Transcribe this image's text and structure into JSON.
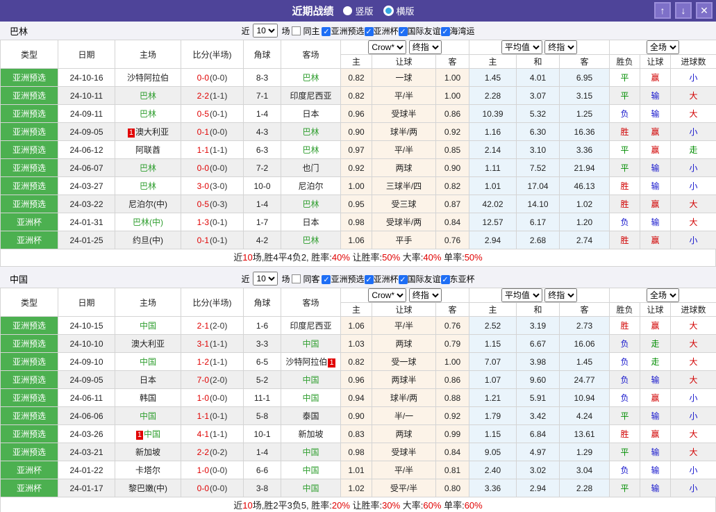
{
  "window": {
    "title": "近期战绩",
    "radios": [
      {
        "label": "竖版",
        "selected": false
      },
      {
        "label": "横版",
        "selected": true
      }
    ],
    "buttons": {
      "up": "↑",
      "down": "↓",
      "close": "✕"
    },
    "colors": {
      "titlebar": "#4e4499",
      "button": "#7e70c8"
    }
  },
  "table_header": {
    "static_cols": [
      "类型",
      "日期",
      "主场",
      "比分(半场)",
      "角球",
      "客场"
    ],
    "odds_group1": {
      "select1": "Crow*",
      "select2": "终指",
      "subcols": [
        "主",
        "让球",
        "客"
      ]
    },
    "odds_group2": {
      "select1": "平均值",
      "select2": "终指",
      "subcols": [
        "主",
        "和",
        "客"
      ]
    },
    "result_group": {
      "select": "全场",
      "subcols": [
        "胜负",
        "让球",
        "进球数"
      ]
    }
  },
  "result_colors": {
    "胜": "#d10000",
    "平": "#008d00",
    "负": "#1515cc",
    "赢": "#d10000",
    "输": "#1515cc",
    "走": "#008d00",
    "大": "#d10000",
    "小": "#1515cc"
  },
  "type_color": "#4cb050",
  "team_highlight_color": "#2f9e2f",
  "sections": [
    {
      "team": "巴林",
      "filter": {
        "prefix": "近",
        "count": "10",
        "suffix": "场",
        "same": {
          "label": "同主",
          "checked": false
        },
        "comps": [
          {
            "label": "亚洲预选",
            "checked": true
          },
          {
            "label": "亚洲杯",
            "checked": true
          },
          {
            "label": "国际友谊",
            "checked": true
          },
          {
            "label": "海湾运",
            "checked": true
          }
        ]
      },
      "rows": [
        {
          "type": "亚洲预选",
          "date": "24-10-16",
          "home": {
            "text": "沙特阿拉伯",
            "green": false
          },
          "score": "0-0",
          "half": "(0-0)",
          "corner": "8-3",
          "away": {
            "text": "巴林",
            "green": true
          },
          "o1": [
            "0.82",
            "一球",
            "1.00"
          ],
          "o2": [
            "1.45",
            "4.01",
            "6.95"
          ],
          "res": [
            "平",
            "赢",
            "小"
          ]
        },
        {
          "type": "亚洲预选",
          "date": "24-10-11",
          "home": {
            "text": "巴林",
            "green": true
          },
          "score": "2-2",
          "half": "(1-1)",
          "corner": "7-1",
          "away": {
            "text": "印度尼西亚",
            "green": false
          },
          "o1": [
            "0.82",
            "平/半",
            "1.00"
          ],
          "o2": [
            "2.28",
            "3.07",
            "3.15"
          ],
          "res": [
            "平",
            "输",
            "大"
          ]
        },
        {
          "type": "亚洲预选",
          "date": "24-09-11",
          "home": {
            "text": "巴林",
            "green": true
          },
          "score": "0-5",
          "half": "(0-1)",
          "corner": "1-4",
          "away": {
            "text": "日本",
            "green": false
          },
          "o1": [
            "0.96",
            "受球半",
            "0.86"
          ],
          "o2": [
            "10.39",
            "5.32",
            "1.25"
          ],
          "res": [
            "负",
            "输",
            "大"
          ]
        },
        {
          "type": "亚洲预选",
          "date": "24-09-05",
          "home": {
            "text": "澳大利亚",
            "green": false,
            "badge": "1",
            "badgePos": "before"
          },
          "score": "0-1",
          "half": "(0-0)",
          "corner": "4-3",
          "away": {
            "text": "巴林",
            "green": true
          },
          "o1": [
            "0.90",
            "球半/两",
            "0.92"
          ],
          "o2": [
            "1.16",
            "6.30",
            "16.36"
          ],
          "res": [
            "胜",
            "赢",
            "小"
          ]
        },
        {
          "type": "亚洲预选",
          "date": "24-06-12",
          "home": {
            "text": "阿联酋",
            "green": false
          },
          "score": "1-1",
          "half": "(1-1)",
          "corner": "6-3",
          "away": {
            "text": "巴林",
            "green": true
          },
          "o1": [
            "0.97",
            "平/半",
            "0.85"
          ],
          "o2": [
            "2.14",
            "3.10",
            "3.36"
          ],
          "res": [
            "平",
            "赢",
            "走"
          ]
        },
        {
          "type": "亚洲预选",
          "date": "24-06-07",
          "home": {
            "text": "巴林",
            "green": true
          },
          "score": "0-0",
          "half": "(0-0)",
          "corner": "7-2",
          "away": {
            "text": "也门",
            "green": false
          },
          "o1": [
            "0.92",
            "两球",
            "0.90"
          ],
          "o2": [
            "1.11",
            "7.52",
            "21.94"
          ],
          "res": [
            "平",
            "输",
            "小"
          ]
        },
        {
          "type": "亚洲预选",
          "date": "24-03-27",
          "home": {
            "text": "巴林",
            "green": true
          },
          "score": "3-0",
          "half": "(3-0)",
          "corner": "10-0",
          "away": {
            "text": "尼泊尔",
            "green": false
          },
          "o1": [
            "1.00",
            "三球半/四",
            "0.82"
          ],
          "o2": [
            "1.01",
            "17.04",
            "46.13"
          ],
          "res": [
            "胜",
            "输",
            "小"
          ]
        },
        {
          "type": "亚洲预选",
          "date": "24-03-22",
          "home": {
            "text": "尼泊尔(中)",
            "green": false
          },
          "score": "0-5",
          "half": "(0-3)",
          "corner": "1-4",
          "away": {
            "text": "巴林",
            "green": true
          },
          "o1": [
            "0.95",
            "受三球",
            "0.87"
          ],
          "o2": [
            "42.02",
            "14.10",
            "1.02"
          ],
          "res": [
            "胜",
            "赢",
            "大"
          ]
        },
        {
          "type": "亚洲杯",
          "date": "24-01-31",
          "home": {
            "text": "巴林(中)",
            "green": true
          },
          "score": "1-3",
          "half": "(0-1)",
          "corner": "1-7",
          "away": {
            "text": "日本",
            "green": false
          },
          "o1": [
            "0.98",
            "受球半/两",
            "0.84"
          ],
          "o2": [
            "12.57",
            "6.17",
            "1.20"
          ],
          "res": [
            "负",
            "输",
            "大"
          ]
        },
        {
          "type": "亚洲杯",
          "date": "24-01-25",
          "home": {
            "text": "约旦(中)",
            "green": false
          },
          "score": "0-1",
          "half": "(0-1)",
          "corner": "4-2",
          "away": {
            "text": "巴林",
            "green": true
          },
          "o1": [
            "1.06",
            "平手",
            "0.76"
          ],
          "o2": [
            "2.94",
            "2.68",
            "2.74"
          ],
          "res": [
            "胜",
            "赢",
            "小"
          ]
        }
      ],
      "summary": [
        [
          "近",
          "n"
        ],
        [
          "10",
          "r"
        ],
        [
          "场,胜4平4负2, 胜率:",
          "n"
        ],
        [
          "40%",
          "r"
        ],
        [
          " 让胜率:",
          "n"
        ],
        [
          "50%",
          "r"
        ],
        [
          " 大率:",
          "n"
        ],
        [
          "40%",
          "r"
        ],
        [
          " 单率:",
          "n"
        ],
        [
          "50%",
          "r"
        ]
      ]
    },
    {
      "team": "中国",
      "filter": {
        "prefix": "近",
        "count": "10",
        "suffix": "场",
        "same": {
          "label": "同客",
          "checked": false
        },
        "comps": [
          {
            "label": "亚洲预选",
            "checked": true
          },
          {
            "label": "亚洲杯",
            "checked": true
          },
          {
            "label": "国际友谊",
            "checked": true
          },
          {
            "label": "东亚杯",
            "checked": true
          }
        ]
      },
      "rows": [
        {
          "type": "亚洲预选",
          "date": "24-10-15",
          "home": {
            "text": "中国",
            "green": true
          },
          "score": "2-1",
          "half": "(2-0)",
          "corner": "1-6",
          "away": {
            "text": "印度尼西亚",
            "green": false
          },
          "o1": [
            "1.06",
            "平/半",
            "0.76"
          ],
          "o2": [
            "2.52",
            "3.19",
            "2.73"
          ],
          "res": [
            "胜",
            "赢",
            "大"
          ]
        },
        {
          "type": "亚洲预选",
          "date": "24-10-10",
          "home": {
            "text": "澳大利亚",
            "green": false
          },
          "score": "3-1",
          "half": "(1-1)",
          "corner": "3-3",
          "away": {
            "text": "中国",
            "green": true
          },
          "o1": [
            "1.03",
            "两球",
            "0.79"
          ],
          "o2": [
            "1.15",
            "6.67",
            "16.06"
          ],
          "res": [
            "负",
            "走",
            "大"
          ]
        },
        {
          "type": "亚洲预选",
          "date": "24-09-10",
          "home": {
            "text": "中国",
            "green": true
          },
          "score": "1-2",
          "half": "(1-1)",
          "corner": "6-5",
          "away": {
            "text": "沙特阿拉伯",
            "green": false,
            "badge": "1",
            "badgePos": "after"
          },
          "o1": [
            "0.82",
            "受一球",
            "1.00"
          ],
          "o2": [
            "7.07",
            "3.98",
            "1.45"
          ],
          "res": [
            "负",
            "走",
            "大"
          ]
        },
        {
          "type": "亚洲预选",
          "date": "24-09-05",
          "home": {
            "text": "日本",
            "green": false
          },
          "score": "7-0",
          "half": "(2-0)",
          "corner": "5-2",
          "away": {
            "text": "中国",
            "green": true
          },
          "o1": [
            "0.96",
            "两球半",
            "0.86"
          ],
          "o2": [
            "1.07",
            "9.60",
            "24.77"
          ],
          "res": [
            "负",
            "输",
            "大"
          ]
        },
        {
          "type": "亚洲预选",
          "date": "24-06-11",
          "home": {
            "text": "韩国",
            "green": false
          },
          "score": "1-0",
          "half": "(0-0)",
          "corner": "11-1",
          "away": {
            "text": "中国",
            "green": true
          },
          "o1": [
            "0.94",
            "球半/两",
            "0.88"
          ],
          "o2": [
            "1.21",
            "5.91",
            "10.94"
          ],
          "res": [
            "负",
            "赢",
            "小"
          ]
        },
        {
          "type": "亚洲预选",
          "date": "24-06-06",
          "home": {
            "text": "中国",
            "green": true
          },
          "score": "1-1",
          "half": "(0-1)",
          "corner": "5-8",
          "away": {
            "text": "泰国",
            "green": false
          },
          "o1": [
            "0.90",
            "半/一",
            "0.92"
          ],
          "o2": [
            "1.79",
            "3.42",
            "4.24"
          ],
          "res": [
            "平",
            "输",
            "小"
          ]
        },
        {
          "type": "亚洲预选",
          "date": "24-03-26",
          "home": {
            "text": "中国",
            "green": true,
            "badge": "1",
            "badgePos": "before"
          },
          "score": "4-1",
          "half": "(1-1)",
          "corner": "10-1",
          "away": {
            "text": "新加坡",
            "green": false
          },
          "o1": [
            "0.83",
            "两球",
            "0.99"
          ],
          "o2": [
            "1.15",
            "6.84",
            "13.61"
          ],
          "res": [
            "胜",
            "赢",
            "大"
          ]
        },
        {
          "type": "亚洲预选",
          "date": "24-03-21",
          "home": {
            "text": "新加坡",
            "green": false
          },
          "score": "2-2",
          "half": "(0-2)",
          "corner": "1-4",
          "away": {
            "text": "中国",
            "green": true
          },
          "o1": [
            "0.98",
            "受球半",
            "0.84"
          ],
          "o2": [
            "9.05",
            "4.97",
            "1.29"
          ],
          "res": [
            "平",
            "输",
            "大"
          ]
        },
        {
          "type": "亚洲杯",
          "date": "24-01-22",
          "home": {
            "text": "卡塔尔",
            "green": false
          },
          "score": "1-0",
          "half": "(0-0)",
          "corner": "6-6",
          "away": {
            "text": "中国",
            "green": true
          },
          "o1": [
            "1.01",
            "平/半",
            "0.81"
          ],
          "o2": [
            "2.40",
            "3.02",
            "3.04"
          ],
          "res": [
            "负",
            "输",
            "小"
          ]
        },
        {
          "type": "亚洲杯",
          "date": "24-01-17",
          "home": {
            "text": "黎巴嫩(中)",
            "green": false
          },
          "score": "0-0",
          "half": "(0-0)",
          "corner": "3-8",
          "away": {
            "text": "中国",
            "green": true
          },
          "o1": [
            "1.02",
            "受平/半",
            "0.80"
          ],
          "o2": [
            "3.36",
            "2.94",
            "2.28"
          ],
          "res": [
            "平",
            "输",
            "小"
          ]
        }
      ],
      "summary": [
        [
          "近",
          "n"
        ],
        [
          "10",
          "r"
        ],
        [
          "场,胜2平3负5, 胜率:",
          "n"
        ],
        [
          "20%",
          "r"
        ],
        [
          " 让胜率:",
          "n"
        ],
        [
          "30%",
          "r"
        ],
        [
          " 大率:",
          "n"
        ],
        [
          "60%",
          "r"
        ],
        [
          " 单率:",
          "n"
        ],
        [
          "60%",
          "r"
        ]
      ]
    }
  ]
}
